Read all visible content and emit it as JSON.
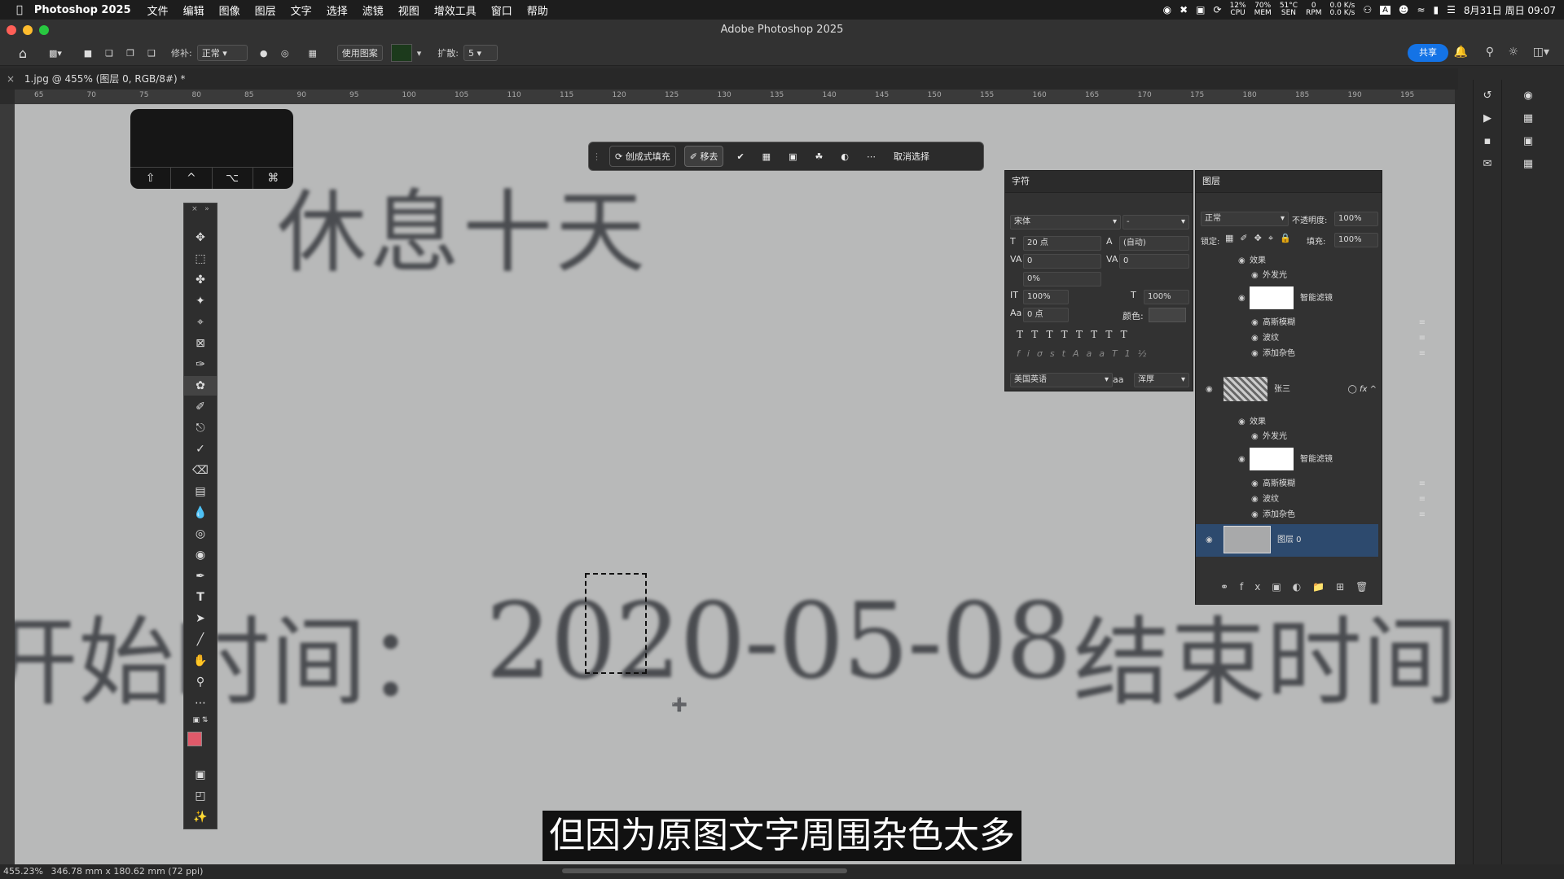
{
  "menubar": {
    "app": "Photoshop 2025",
    "items": [
      "文件",
      "编辑",
      "图像",
      "图层",
      "文字",
      "选择",
      "滤镜",
      "视图",
      "增效工具",
      "窗口",
      "帮助"
    ],
    "cpu": [
      "12%",
      "CPU"
    ],
    "mem": [
      "70%",
      "MEM"
    ],
    "temp": [
      "51°C",
      "SEN"
    ],
    "rpm": [
      "0",
      "RPM"
    ],
    "net": [
      "0.0 K/s",
      "0.0 K/s"
    ],
    "datetime": "8月31日 周日 09:07"
  },
  "window": {
    "title": "Adobe Photoshop 2025"
  },
  "options": {
    "mode_label": "修补:",
    "mode_value": "正常",
    "use_pattern": "使用图案",
    "spread_label": "扩散:",
    "spread_value": "5",
    "share": "共享"
  },
  "document": {
    "tab": "1.jpg @ 455% (图层 0, RGB/8#) *"
  },
  "ruler": {
    "h_ticks": [
      "65",
      "70",
      "75",
      "80",
      "85",
      "90",
      "95",
      "100",
      "105",
      "110",
      "115",
      "120",
      "125",
      "130",
      "135",
      "140",
      "145",
      "150",
      "155",
      "160",
      "165",
      "170",
      "175",
      "180",
      "185",
      "190",
      "195"
    ]
  },
  "canvas": {
    "line1": "休息十天",
    "line2a": "开始时间：",
    "line2b": "2020-05-08",
    "line2c": "结束时间",
    "subtitle": "但因为原图文字周围杂色太多"
  },
  "keys": [
    "⇧",
    "^",
    "⌥",
    "⌘"
  ],
  "context_bar": {
    "fill": "创成式填充",
    "remove": "移去",
    "deselect": "取消选择"
  },
  "character": {
    "title": "字符",
    "font": "宋体",
    "style": "-",
    "size": "20 点",
    "leading": "(自动)",
    "kerning": "0",
    "tracking": "0",
    "scale_pct": "0%",
    "v_scale": "100%",
    "h_scale": "100%",
    "baseline": "0 点",
    "color_label": "颜色:",
    "language": "美国英语",
    "aa_label": "aa",
    "antialias": "浑厚"
  },
  "layers": {
    "title": "图层",
    "blend": "正常",
    "opacity_label": "不透明度:",
    "opacity": "100%",
    "lock_label": "锁定:",
    "fill_label": "填充:",
    "fill": "100%",
    "rows": {
      "effects1": "效果",
      "glow1": "外发光",
      "smart1": "智能滤镜",
      "gauss1": "高斯模糊",
      "ripple1": "波纹",
      "noise1": "添加杂色",
      "zhangsan": "张三",
      "effects2": "效果",
      "glow2": "外发光",
      "smart2": "智能滤镜",
      "gauss2": "高斯模糊",
      "ripple2": "波纹",
      "noise2": "添加杂色",
      "layer0": "图层 0"
    }
  },
  "status": {
    "zoom": "455.23%",
    "info": "346.78 mm x 180.62 mm (72 ppi)"
  },
  "colors": {
    "foreground": "#e05a6a",
    "background": "#ffffff",
    "accent": "#1473e6"
  }
}
